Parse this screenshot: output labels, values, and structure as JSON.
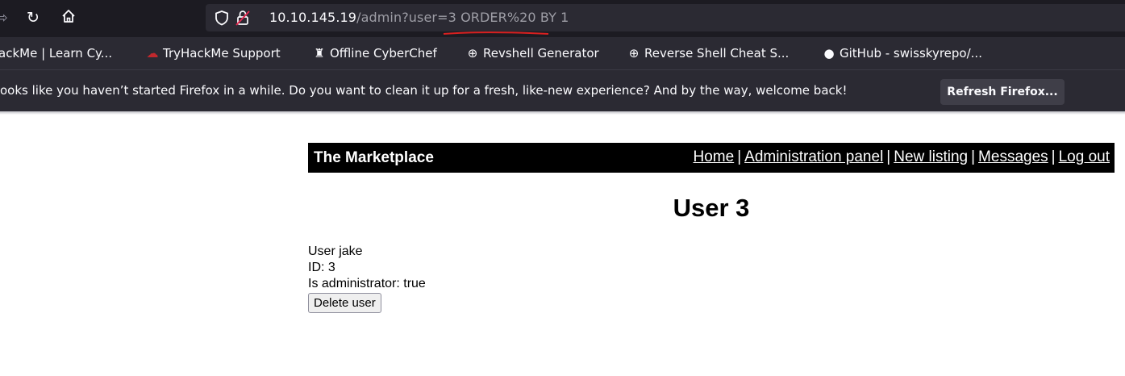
{
  "browser": {
    "url_host": "10.10.145.19",
    "url_path": "/admin?user=3 ORDER%20 BY 1",
    "bookmarks": [
      {
        "label": "ackMe | Learn Cy...",
        "icon": "tryhackme-icon"
      },
      {
        "label": "TryHackMe Support",
        "icon": "cloud-icon"
      },
      {
        "label": "Offline CyberChef",
        "icon": "chef-hat-icon"
      },
      {
        "label": "Revshell Generator",
        "icon": "globe-icon"
      },
      {
        "label": "Reverse Shell Cheat S...",
        "icon": "globe-icon"
      },
      {
        "label": "GitHub - swisskyrepo/...",
        "icon": "github-icon"
      }
    ],
    "notice_text": "ooks like you haven’t started Firefox in a while. Do you want to clean it up for a fresh, like-new experience? And by the way, welcome back!",
    "refresh_label": "Refresh Firefox...",
    "colors": {
      "annotation_underline": "#d92020"
    }
  },
  "site": {
    "title": "The Marketplace",
    "nav": [
      "Home",
      "Administration panel",
      "New listing",
      "Messages",
      "Log out"
    ],
    "nav_separator": "|"
  },
  "user": {
    "heading": "User 3",
    "name_line": "User jake",
    "id_line": "ID: 3",
    "admin_line": "Is administrator: true",
    "delete_label": "Delete user"
  }
}
